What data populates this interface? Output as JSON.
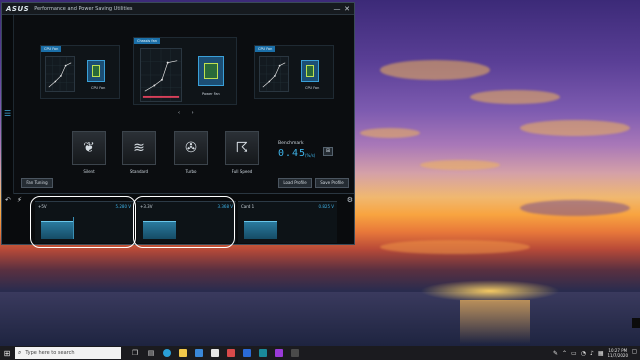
{
  "window": {
    "logo": "ASUS",
    "title": "Performance and Power Saving Utilities",
    "minimize": "—",
    "close": "✕"
  },
  "fan_panels": [
    {
      "tab": "CPU Fan",
      "label": "CPU Fan"
    },
    {
      "tab": "Chassis fan",
      "label": "Power Fan"
    },
    {
      "tab": "CPU Fan",
      "label": "CPU Fan"
    }
  ],
  "pager": "‹ ›",
  "modes": [
    {
      "label": "Silent",
      "icon": "leaf-icon",
      "glyph": "❦"
    },
    {
      "label": "Standard",
      "icon": "wind-icon",
      "glyph": "≋"
    },
    {
      "label": "Turbo",
      "icon": "fan-icon",
      "glyph": "✇"
    },
    {
      "label": "Full Speed",
      "icon": "tornado-icon",
      "glyph": "☈"
    }
  ],
  "benchmark": {
    "label": "Benchmark",
    "value": "0.45",
    "unit": "(%/s)"
  },
  "buttons": {
    "fan_tuning": "Fan Tuning",
    "load_profile": "Load Profile",
    "save_profile": "Save Profile"
  },
  "voltages": [
    {
      "name": "+5V",
      "value": "5.280 V",
      "level": 0.35
    },
    {
      "name": "+3.3V",
      "value": "3.368 V",
      "level": 0.35
    },
    {
      "name": "Card 1",
      "value": "0.825 V",
      "level": 0.35
    }
  ],
  "taskbar": {
    "search_placeholder": "Type here to search",
    "time": "10:27 PM",
    "date": "11/7/2020"
  }
}
